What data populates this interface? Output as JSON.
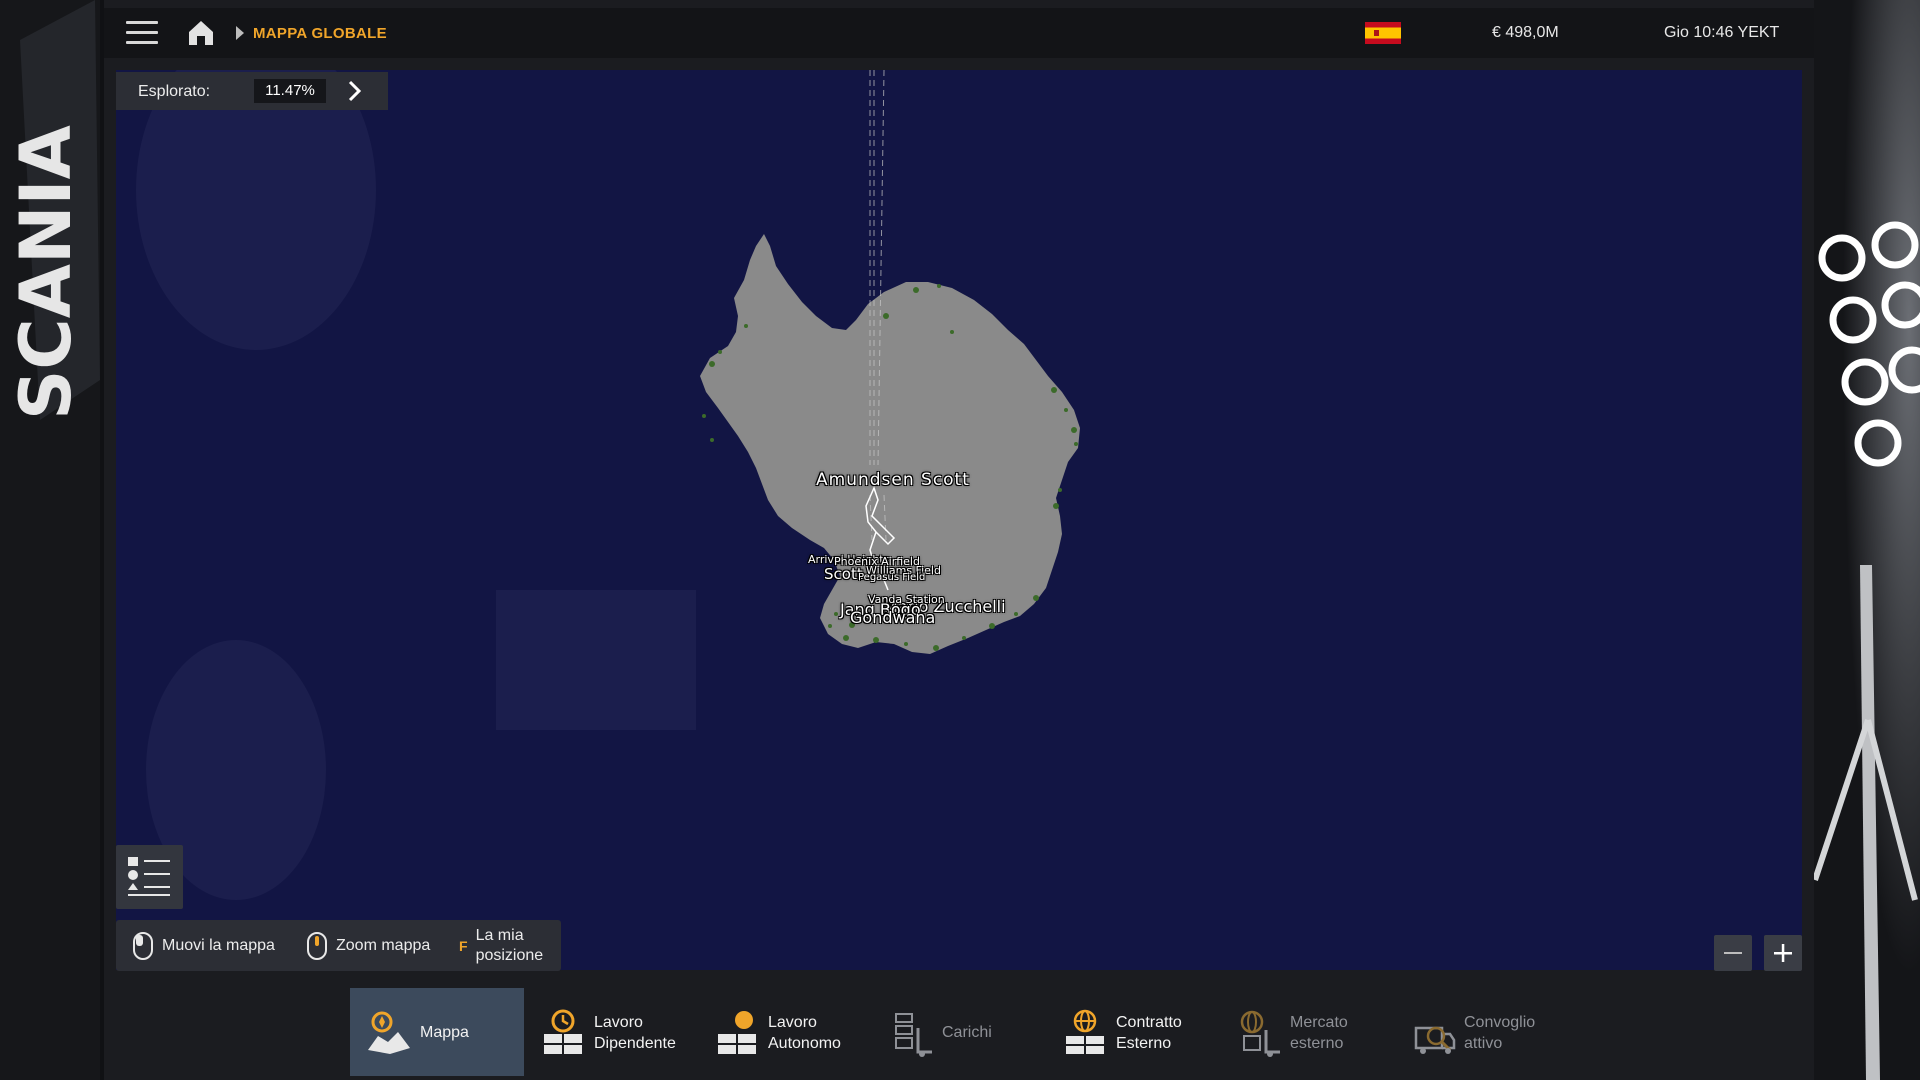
{
  "header": {
    "breadcrumb": "MAPPA GLOBALE",
    "money": "€ 498,0M",
    "clock": "Gio 10:46 YEKT",
    "flag_icon": "spain-flag-icon"
  },
  "explored": {
    "label": "Esplorato:",
    "value": "11.47%",
    "value_fraction": 0.1147
  },
  "map": {
    "water_color": "#121544",
    "land_color": "#8a8a8a",
    "vegetation_color": "#3c6b2a",
    "labels": [
      "Amundsen Scott",
      "Arrival Heights",
      "Phoenix Airfield",
      "Scott",
      "Williams Field",
      "Pegasus Field",
      "Mario Zucchelli",
      "Vanda Station",
      "Jang Bogo",
      "Gondwana"
    ]
  },
  "controls": {
    "move_map": "Muovi la mappa",
    "zoom_map": "Zoom mappa",
    "position_key": "F",
    "my_position_line1": "La mia",
    "my_position_line2": "posizione"
  },
  "nav": {
    "tabs": [
      {
        "line1": "Mappa",
        "line2": "",
        "icon": "map-icon",
        "active": true
      },
      {
        "line1": "Lavoro",
        "line2": "Dipendente",
        "icon": "employee-job-icon",
        "active": false
      },
      {
        "line1": "Lavoro",
        "line2": "Autonomo",
        "icon": "freelance-job-icon",
        "active": false
      },
      {
        "line1": "Carichi",
        "line2": "",
        "icon": "cargo-icon",
        "active": false
      },
      {
        "line1": "Contratto",
        "line2": "Esterno",
        "icon": "external-contract-icon",
        "active": false
      },
      {
        "line1": "Mercato",
        "line2": "esterno",
        "icon": "external-market-icon",
        "active": false
      },
      {
        "line1": "Convoglio",
        "line2": "attivo",
        "icon": "active-convoy-icon",
        "active": false
      }
    ]
  },
  "colors": {
    "accent": "#f0a52a",
    "active_tab": "#3c4a5c",
    "panel": "#2c2e35"
  }
}
